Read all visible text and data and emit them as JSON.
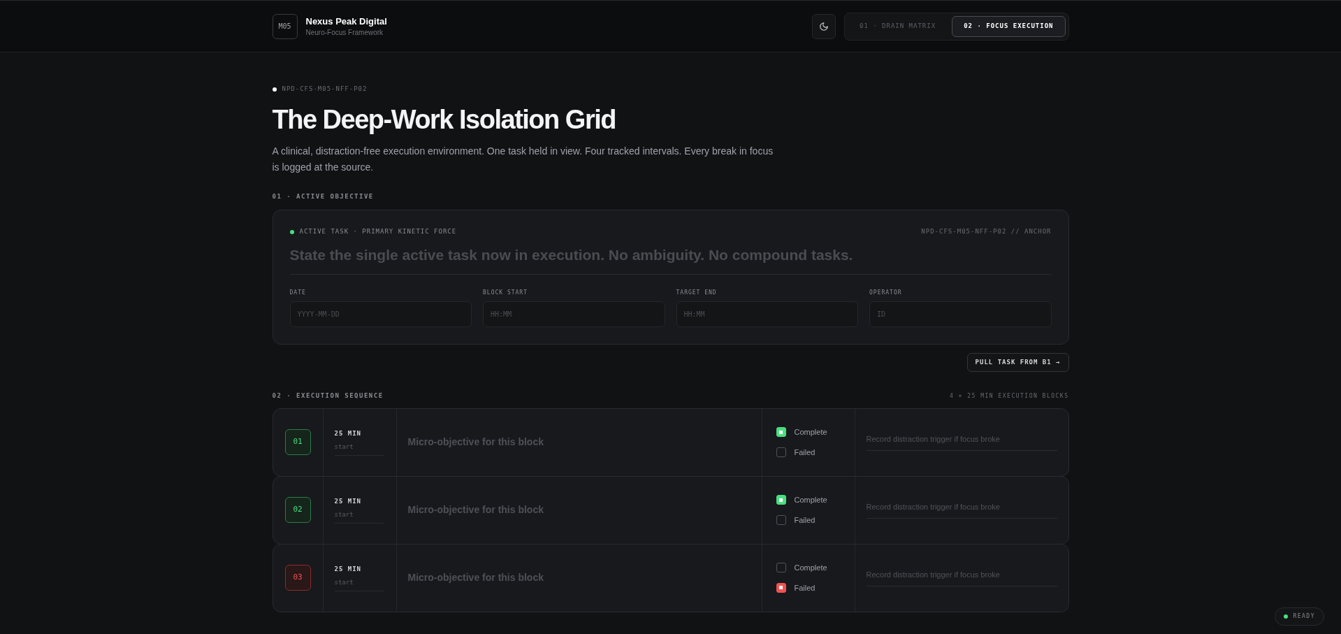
{
  "header": {
    "logo": "M05",
    "brand": "Nexus Peak Digital",
    "subtitle": "Neuro-Focus Framework",
    "tabs": [
      {
        "label": "01 · DRAIN MATRIX",
        "selected": false
      },
      {
        "label": "02 · FOCUS EXECUTION",
        "selected": true
      }
    ]
  },
  "doc_code": "NPD-CFS-M05-NFF-P02",
  "title": "The Deep-Work Isolation Grid",
  "intro": "A clinical, distraction-free execution environment. One task held in view. Four tracked intervals. Every break in focus is logged at the source.",
  "objective": {
    "section": "01 · ACTIVE OBJECTIVE",
    "status": "ACTIVE TASK · PRIMARY KINETIC FORCE",
    "anchor": "NPD-CFS-M05-NFF-P02 // ANCHOR",
    "task_placeholder": "State the single active task now in execution. No ambiguity. No compound tasks.",
    "fields": [
      {
        "label": "DATE",
        "placeholder": "YYYY-MM-DD"
      },
      {
        "label": "BLOCK START",
        "placeholder": "HH:MM"
      },
      {
        "label": "TARGET END",
        "placeholder": "HH:MM"
      },
      {
        "label": "OPERATOR",
        "placeholder": "ID"
      }
    ],
    "pull_button": "PULL TASK FROM B1 →"
  },
  "sequence": {
    "section": "02 · EXECUTION SEQUENCE",
    "summary": "4 × 25 MIN EXECUTION BLOCKS",
    "blocks": [
      {
        "index": "01",
        "duration": "25 MIN",
        "start_placeholder": "start",
        "objective_placeholder": "Micro-objective for this block",
        "complete": {
          "label": "Complete",
          "checked": true
        },
        "failed": {
          "label": "Failed",
          "checked": false
        },
        "note_placeholder": "Record distraction trigger if focus broke"
      },
      {
        "index": "02",
        "duration": "25 MIN",
        "start_placeholder": "start",
        "objective_placeholder": "Micro-objective for this block",
        "complete": {
          "label": "Complete",
          "checked": true
        },
        "failed": {
          "label": "Failed",
          "checked": false
        },
        "note_placeholder": "Record distraction trigger if focus broke"
      },
      {
        "index": "03",
        "duration": "25 MIN",
        "start_placeholder": "start",
        "objective_placeholder": "Micro-objective for this block",
        "complete": {
          "label": "Complete",
          "checked": false
        },
        "failed": {
          "label": "Failed",
          "checked": true
        },
        "note_placeholder": "Record distraction trigger if focus broke"
      }
    ]
  },
  "status_badge": "READY"
}
